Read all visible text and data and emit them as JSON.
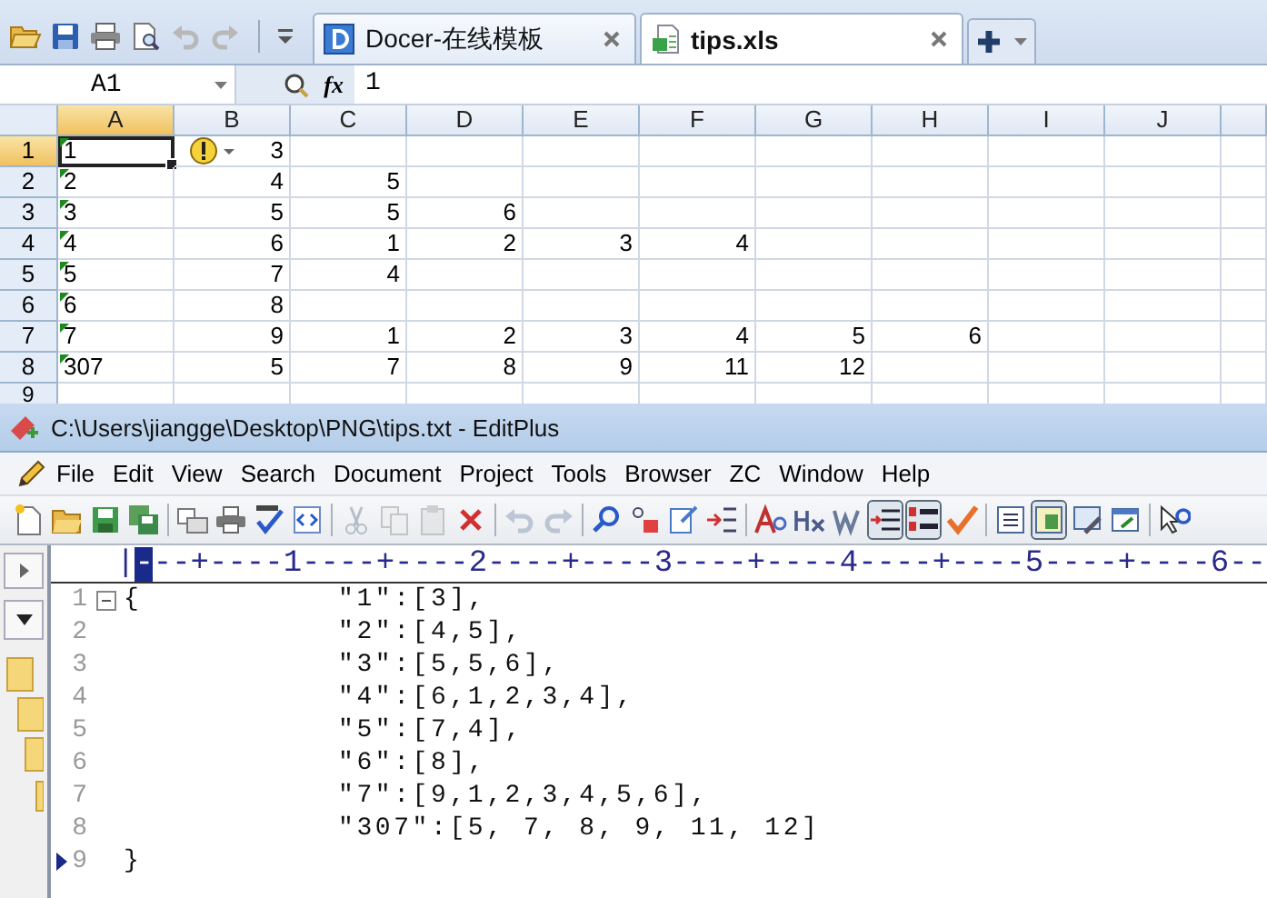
{
  "spreadsheet": {
    "quick_access": [
      {
        "kind": "open",
        "disabled": false
      },
      {
        "kind": "save",
        "disabled": false
      },
      {
        "kind": "print",
        "disabled": false
      },
      {
        "kind": "preview",
        "disabled": false
      },
      {
        "kind": "undo",
        "disabled": true
      },
      {
        "kind": "redo",
        "disabled": true
      }
    ],
    "tabs": [
      {
        "label": "Docer-在线模板",
        "kind": "docer",
        "selected": false
      },
      {
        "label": "tips.xls",
        "kind": "sheet",
        "selected": true
      }
    ],
    "name_box": "A1",
    "function_label": "fx",
    "formula": "1",
    "columns": [
      {
        "label": "A",
        "selected": true
      },
      {
        "label": "B",
        "selected": false
      },
      {
        "label": "C",
        "selected": false
      },
      {
        "label": "D",
        "selected": false
      },
      {
        "label": "E",
        "selected": false
      },
      {
        "label": "F",
        "selected": false
      },
      {
        "label": "G",
        "selected": false
      },
      {
        "label": "H",
        "selected": false
      },
      {
        "label": "I",
        "selected": false
      },
      {
        "label": "J",
        "selected": false
      }
    ],
    "error_tag": true,
    "rows": [
      {
        "header": "1",
        "selected": true,
        "cells": [
          {
            "value": "1",
            "kind": "text",
            "active": true
          },
          {
            "value": "3",
            "kind": "number",
            "active": false
          }
        ]
      },
      {
        "header": "2",
        "selected": false,
        "cells": [
          {
            "value": "2",
            "kind": "text",
            "active": false
          },
          {
            "value": "4",
            "kind": "number",
            "active": false
          },
          {
            "value": "5",
            "kind": "number",
            "active": false
          }
        ]
      },
      {
        "header": "3",
        "selected": false,
        "cells": [
          {
            "value": "3",
            "kind": "text",
            "active": false
          },
          {
            "value": "5",
            "kind": "number",
            "active": false
          },
          {
            "value": "5",
            "kind": "number",
            "active": false
          },
          {
            "value": "6",
            "kind": "number",
            "active": false
          }
        ]
      },
      {
        "header": "4",
        "selected": false,
        "cells": [
          {
            "value": "4",
            "kind": "text",
            "active": false
          },
          {
            "value": "6",
            "kind": "number",
            "active": false
          },
          {
            "value": "1",
            "kind": "number",
            "active": false
          },
          {
            "value": "2",
            "kind": "number",
            "active": false
          },
          {
            "value": "3",
            "kind": "number",
            "active": false
          },
          {
            "value": "4",
            "kind": "number",
            "active": false
          }
        ]
      },
      {
        "header": "5",
        "selected": false,
        "cells": [
          {
            "value": "5",
            "kind": "text",
            "active": false
          },
          {
            "value": "7",
            "kind": "number",
            "active": false
          },
          {
            "value": "4",
            "kind": "number",
            "active": false
          }
        ]
      },
      {
        "header": "6",
        "selected": false,
        "cells": [
          {
            "value": "6",
            "kind": "text",
            "active": false
          },
          {
            "value": "8",
            "kind": "number",
            "active": false
          }
        ]
      },
      {
        "header": "7",
        "selected": false,
        "cells": [
          {
            "value": "7",
            "kind": "text",
            "active": false
          },
          {
            "value": "9",
            "kind": "number",
            "active": false
          },
          {
            "value": "1",
            "kind": "number",
            "active": false
          },
          {
            "value": "2",
            "kind": "number",
            "active": false
          },
          {
            "value": "3",
            "kind": "number",
            "active": false
          },
          {
            "value": "4",
            "kind": "number",
            "active": false
          },
          {
            "value": "5",
            "kind": "number",
            "active": false
          },
          {
            "value": "6",
            "kind": "number",
            "active": false
          }
        ]
      },
      {
        "header": "8",
        "selected": false,
        "cells": [
          {
            "value": "307",
            "kind": "text",
            "active": false
          },
          {
            "value": "5",
            "kind": "number",
            "active": false
          },
          {
            "value": "7",
            "kind": "number",
            "active": false
          },
          {
            "value": "8",
            "kind": "number",
            "active": false
          },
          {
            "value": "9",
            "kind": "number",
            "active": false
          },
          {
            "value": "11",
            "kind": "number",
            "active": false
          },
          {
            "value": "12",
            "kind": "number",
            "active": false
          }
        ]
      },
      {
        "header": "9",
        "selected": false,
        "cells": []
      }
    ]
  },
  "editor": {
    "title": "C:\\Users\\jiangge\\Desktop\\PNG\\tips.txt - EditPlus",
    "menu": [
      "File",
      "Edit",
      "View",
      "Search",
      "Document",
      "Project",
      "Tools",
      "Browser",
      "ZC",
      "Window",
      "Help"
    ],
    "toolbar": [
      {
        "kind": "new",
        "pressed": false,
        "disabled": false
      },
      {
        "kind": "open",
        "pressed": false,
        "disabled": false
      },
      {
        "kind": "save",
        "pressed": false,
        "disabled": false
      },
      {
        "kind": "save-all",
        "pressed": false,
        "disabled": false
      },
      {
        "kind": "sep"
      },
      {
        "kind": "preview",
        "pressed": false,
        "disabled": false
      },
      {
        "kind": "print",
        "pressed": false,
        "disabled": false
      },
      {
        "kind": "spell",
        "pressed": false,
        "disabled": false
      },
      {
        "kind": "browser",
        "pressed": false,
        "disabled": false
      },
      {
        "kind": "sep"
      },
      {
        "kind": "cut",
        "pressed": false,
        "disabled": true
      },
      {
        "kind": "copy",
        "pressed": false,
        "disabled": true
      },
      {
        "kind": "paste",
        "pressed": false,
        "disabled": true
      },
      {
        "kind": "delete",
        "pressed": false,
        "disabled": false
      },
      {
        "kind": "sep"
      },
      {
        "kind": "undo",
        "pressed": false,
        "disabled": true
      },
      {
        "kind": "redo",
        "pressed": false,
        "disabled": true
      },
      {
        "kind": "sep"
      },
      {
        "kind": "find",
        "pressed": false,
        "disabled": false
      },
      {
        "kind": "replace",
        "pressed": false,
        "disabled": false
      },
      {
        "kind": "goto",
        "pressed": false,
        "disabled": false
      },
      {
        "kind": "numbering",
        "pressed": false,
        "disabled": false
      },
      {
        "kind": "sep"
      },
      {
        "kind": "font",
        "pressed": false,
        "disabled": false
      },
      {
        "kind": "heading",
        "pressed": false,
        "disabled": false
      },
      {
        "kind": "wrap",
        "pressed": false,
        "disabled": false
      },
      {
        "kind": "indent",
        "pressed": true,
        "disabled": false
      },
      {
        "kind": "linenumbers",
        "pressed": true,
        "disabled": false
      },
      {
        "kind": "check",
        "pressed": false,
        "disabled": false
      },
      {
        "kind": "sep"
      },
      {
        "kind": "list",
        "pressed": false,
        "disabled": false
      },
      {
        "kind": "panel",
        "pressed": true,
        "disabled": false
      },
      {
        "kind": "tools",
        "pressed": false,
        "disabled": false
      },
      {
        "kind": "window",
        "pressed": false,
        "disabled": false
      },
      {
        "kind": "sep"
      },
      {
        "kind": "help",
        "pressed": false,
        "disabled": false
      }
    ],
    "ruler": {
      "before": "|",
      "cursor": "-",
      "after": "--+----1----+----2----+----3----+----4----+----5----+----6--"
    },
    "lines": [
      {
        "number": "1",
        "lead": "{",
        "text": "\"1\":[3],",
        "foldable": true,
        "current": false
      },
      {
        "number": "2",
        "text": "\"2\":[4,5],",
        "foldable": false,
        "current": false
      },
      {
        "number": "3",
        "text": "\"3\":[5,5,6],",
        "foldable": false,
        "current": false
      },
      {
        "number": "4",
        "text": "\"4\":[6,1,2,3,4],",
        "foldable": false,
        "current": false
      },
      {
        "number": "5",
        "text": "\"5\":[7,4],",
        "foldable": false,
        "current": false
      },
      {
        "number": "6",
        "text": "\"6\":[8],",
        "foldable": false,
        "current": false
      },
      {
        "number": "7",
        "text": "\"7\":[9,1,2,3,4,5,6],",
        "foldable": false,
        "current": false
      },
      {
        "number": "8",
        "text": "\"307\":[5, 7, 8, 9, 11, 12]",
        "foldable": false,
        "current": false
      },
      {
        "number": "9",
        "lead": "}",
        "foldable": false,
        "current": true
      }
    ]
  }
}
